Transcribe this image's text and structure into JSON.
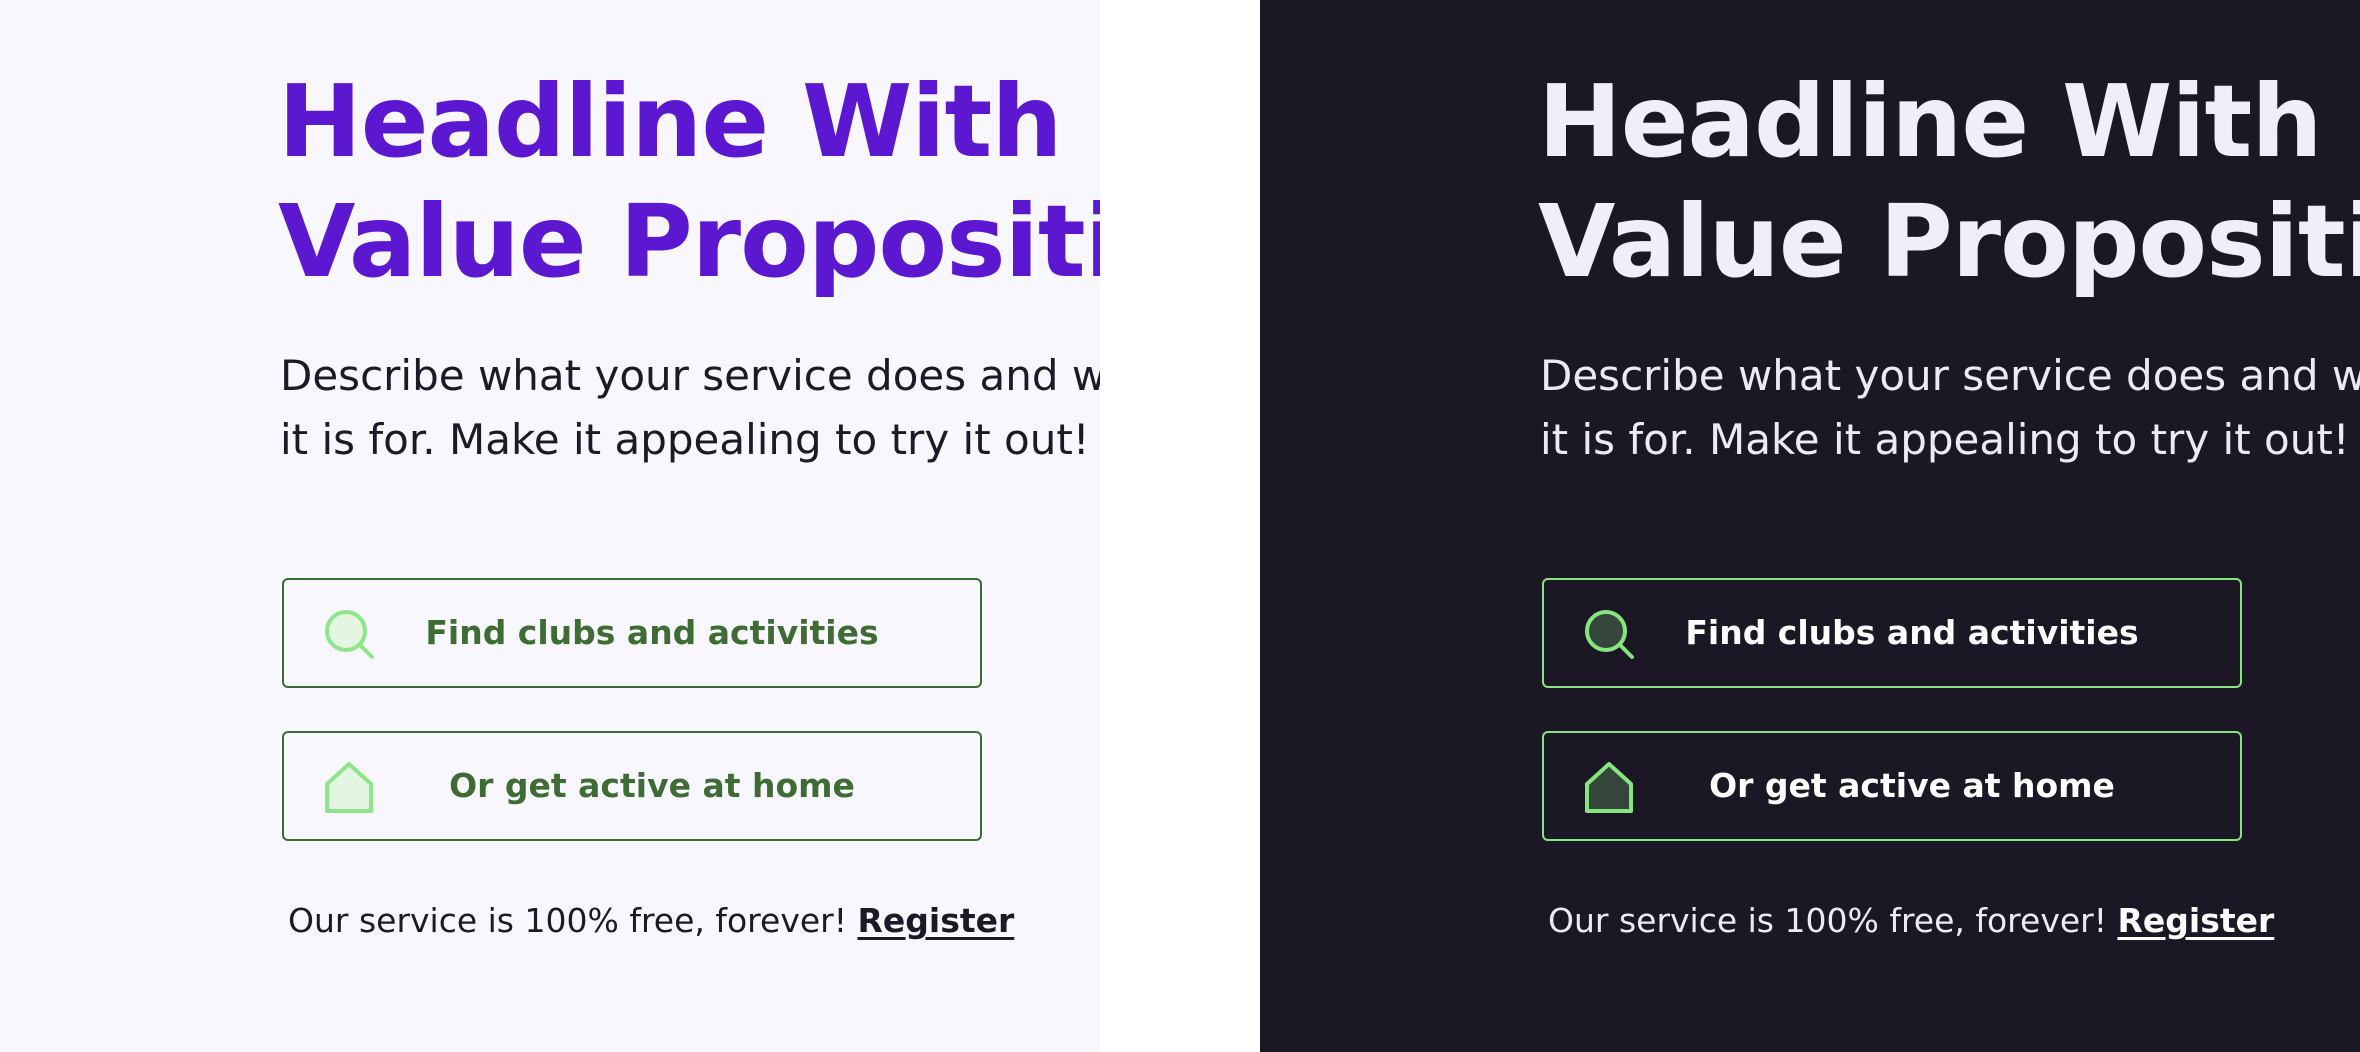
{
  "hero": {
    "headline_line1": "Headline With Un",
    "headline_line2": "Value Propositio",
    "description_line1": "Describe what your service does and w",
    "description_line2": "it is for. Make it appealing to try it out!",
    "find_button_label": "Find clubs and activities",
    "home_button_label": "Or get active at home",
    "footer_text": "Our service is 100% free, forever!",
    "register_link": "Register",
    "find_icon": "search-icon",
    "home_icon": "home-icon"
  },
  "themes": {
    "light": {
      "background": "#f8f7fd",
      "headline_color": "#5b18d0",
      "text_color": "#1d1a27",
      "button_border": "#3d6b35",
      "button_text": "#3f6b34",
      "icon_stroke": "#8fe58a",
      "icon_fill": "#e4f6e2"
    },
    "dark": {
      "background": "#1b1724",
      "headline_color": "#efeefa",
      "text_color": "#ecebf5",
      "button_border": "#86e57f",
      "button_text": "#ffffff",
      "icon_stroke": "#86e57f",
      "icon_fill": "#34473a"
    }
  }
}
